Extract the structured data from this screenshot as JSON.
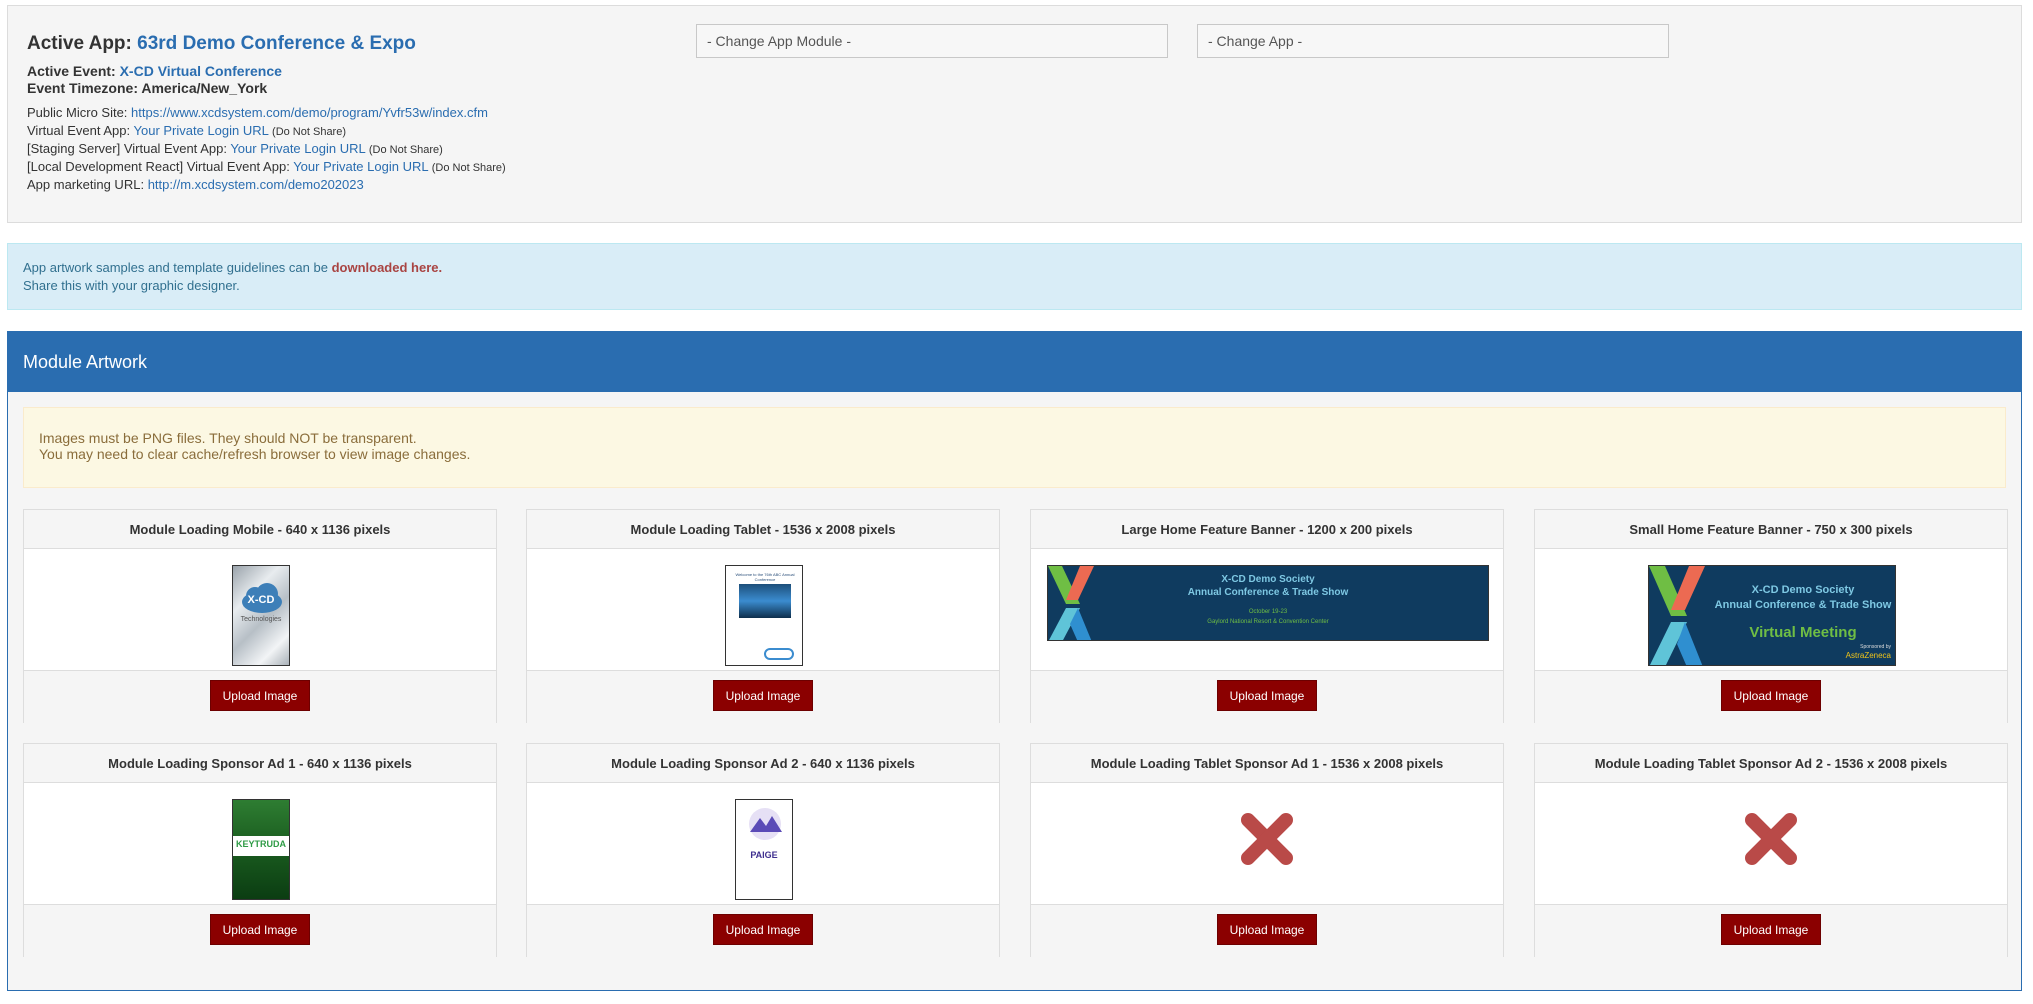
{
  "header": {
    "active_app_label": "Active App:",
    "active_app_name": "63rd Demo Conference & Expo",
    "active_event_label": "Active Event:",
    "active_event_name": "X-CD Virtual Conference",
    "timezone_label": "Event Timezone:",
    "timezone_value": "America/New_York",
    "micro_site_label": "Public Micro Site:",
    "micro_site_url": "https://www.xcdsystem.com/demo/program/Yvfr53w/index.cfm",
    "virtual_app_label": "Virtual Event App:",
    "virtual_app_link": "Your Private Login URL",
    "virtual_app_note": "(Do Not Share)",
    "staging_label": "[Staging Server] Virtual Event App:",
    "staging_link": "Your Private Login URL",
    "staging_note": "(Do Not Share)",
    "local_label": "[Local Development React] Virtual Event App:",
    "local_link": "Your Private Login URL",
    "local_note": "(Do Not Share)",
    "marketing_label": "App marketing URL:",
    "marketing_url": "http://m.xcdsystem.com/demo202023",
    "change_module_placeholder": "- Change App Module -",
    "change_app_placeholder": "- Change App -"
  },
  "info_alert": {
    "line1_prefix": "App artwork samples and template guidelines can be ",
    "line1_link": "downloaded here.",
    "line2": "Share this with your graphic designer."
  },
  "artwork": {
    "title": "Module Artwork",
    "warning_line1": "Images must be PNG files. They should NOT be transparent.",
    "warning_line2": "You may need to clear cache/refresh browser to view image changes.",
    "upload_label": "Upload Image",
    "cards": [
      {
        "title": "Module Loading Mobile - 640 x 1136 pixels",
        "has_image": true
      },
      {
        "title": "Module Loading Tablet - 1536 x 2008 pixels",
        "has_image": true
      },
      {
        "title": "Large Home Feature Banner - 1200 x 200 pixels",
        "has_image": true
      },
      {
        "title": "Small Home Feature Banner - 750 x 300 pixels",
        "has_image": true
      },
      {
        "title": "Module Loading Sponsor Ad 1 - 640 x 1136 pixels",
        "has_image": true
      },
      {
        "title": "Module Loading Sponsor Ad 2 - 640 x 1136 pixels",
        "has_image": true
      },
      {
        "title": "Module Loading Tablet Sponsor Ad 1 - 1536 x 2008 pixels",
        "has_image": false
      },
      {
        "title": "Module Loading Tablet Sponsor Ad 2 - 1536 x 2008 pixels",
        "has_image": false
      }
    ],
    "images": {
      "mobile_logo": "X-CD",
      "mobile_logo_sub": "Technologies",
      "tablet_text": "Welcome to the 76th ABC Annual Conference",
      "banner_title": "X-CD Demo Society",
      "banner_subtitle": "Annual Conference & Trade Show",
      "banner_date": "October 19-23",
      "banner_venue": "Gaylord National Resort & Convention Center",
      "banner_virtual": "Virtual Meeting",
      "banner_sponsor_prefix": "Sponsored by",
      "banner_sponsor": "AstraZeneca",
      "sponsor1_brand": "KEYTRUDA",
      "sponsor2_brand": "PAIGE"
    }
  },
  "colors": {
    "primary": "#2a6db0",
    "danger_button": "#8b0000",
    "missing_icon": "#b94a48",
    "info_bg": "#d9edf7",
    "warning_bg": "#fcf8e3"
  }
}
